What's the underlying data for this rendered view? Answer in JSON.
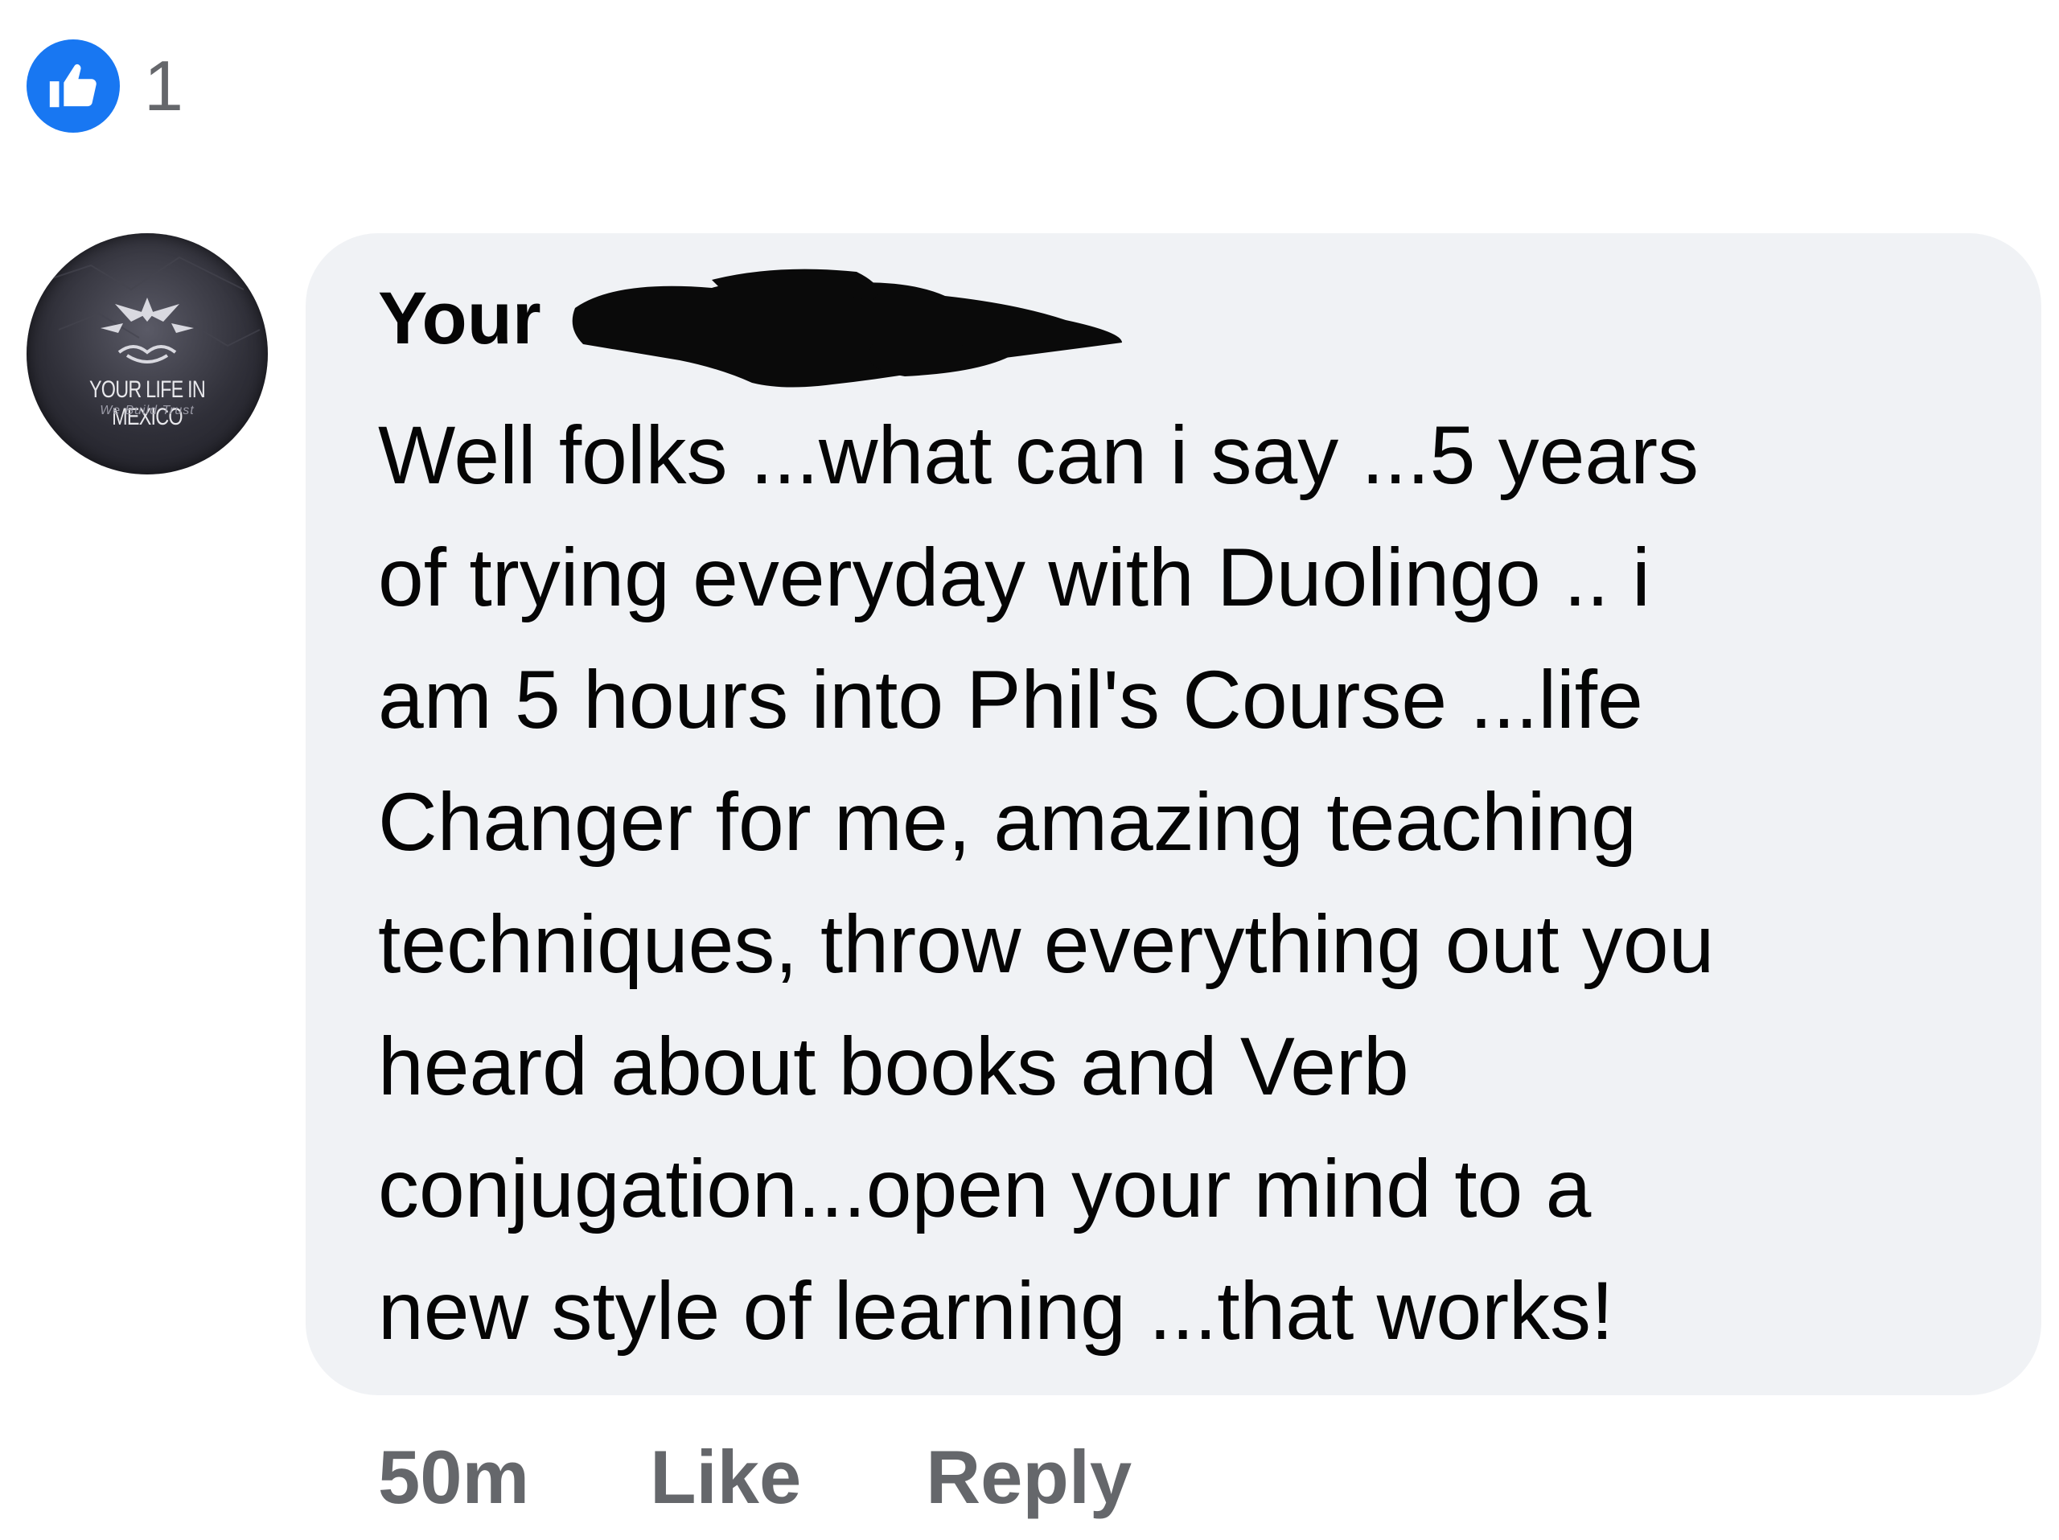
{
  "reactions": {
    "icon": "thumbs-up-icon",
    "color": "#1877f2",
    "count": "1"
  },
  "comment": {
    "avatar": {
      "title": "YOUR LIFE IN MEXICO",
      "tagline": "We Build Trust"
    },
    "author_visible": "Your",
    "body_lines": [
      "Well folks ...what can i say ...5 years",
      "of trying everyday with Duolingo .. i",
      "am 5 hours into Phil's Course ...life",
      "Changer for me, amazing teaching",
      "techniques, throw everything out you",
      "heard about books and Verb",
      "conjugation...open your mind to  a",
      "new style of learning ...that works!"
    ],
    "bubble_color": "#f0f2f5"
  },
  "actions": {
    "timestamp": "50m",
    "like_label": "Like",
    "reply_label": "Reply"
  }
}
